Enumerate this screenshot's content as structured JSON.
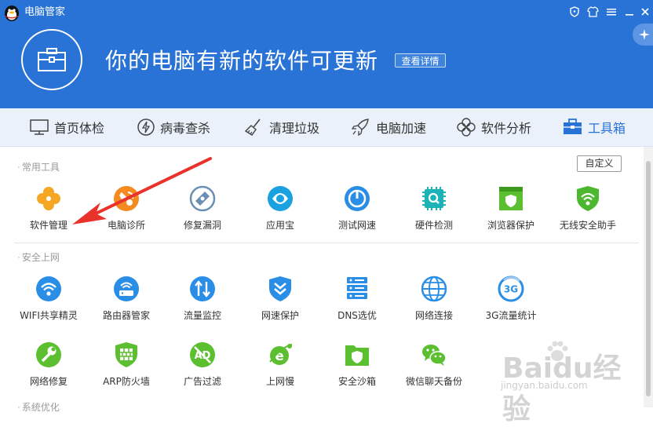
{
  "window": {
    "title": "电脑管家"
  },
  "banner": {
    "headline": "你的电脑有新的软件可更新",
    "detail_button": "查看详情"
  },
  "nav": {
    "items": [
      {
        "label": "首页体检"
      },
      {
        "label": "病毒查杀"
      },
      {
        "label": "清理垃圾"
      },
      {
        "label": "电脑加速"
      },
      {
        "label": "软件分析"
      },
      {
        "label": "工具箱"
      }
    ]
  },
  "sections": [
    {
      "title": "常用工具",
      "tools": [
        {
          "label": "软件管理",
          "color": "#f5a623"
        },
        {
          "label": "电脑诊所",
          "color": "#f58a1f"
        },
        {
          "label": "修复漏洞",
          "color": "#6b8fb3"
        },
        {
          "label": "应用宝",
          "color": "#1aa2e0"
        },
        {
          "label": "测试网速",
          "color": "#2a8ee6"
        },
        {
          "label": "硬件检测",
          "color": "#1bb3b5"
        },
        {
          "label": "浏览器保护",
          "color": "#5bbf2f"
        },
        {
          "label": "无线安全助手",
          "color": "#4cb830"
        }
      ]
    },
    {
      "title": "安全上网",
      "tools": [
        {
          "label": "WIFI共享精灵",
          "color": "#2a8ee6"
        },
        {
          "label": "路由器管家",
          "color": "#2a8ee6"
        },
        {
          "label": "流量监控",
          "color": "#2a8ee6"
        },
        {
          "label": "网速保护",
          "color": "#2a8ee6"
        },
        {
          "label": "DNS选优",
          "color": "#2a8ee6"
        },
        {
          "label": "网络连接",
          "color": "#2a8ee6"
        },
        {
          "label": "3G流量统计",
          "color": "#2a8ee6"
        }
      ]
    },
    {
      "title": "系统优化",
      "tools": [
        {
          "label": "网络修复",
          "color": "#5bbf2f"
        },
        {
          "label": "ARP防火墙",
          "color": "#5bbf2f"
        },
        {
          "label": "广告过滤",
          "color": "#5bbf2f"
        },
        {
          "label": "上网慢",
          "color": "#5bbf2f"
        },
        {
          "label": "安全沙箱",
          "color": "#5bbf2f"
        },
        {
          "label": "微信聊天备份",
          "color": "#5bbf2f"
        }
      ]
    }
  ],
  "custom_button": "自定义",
  "watermark": {
    "text": "Baidu经验",
    "sub": "jingyan.baidu.com"
  },
  "colors": {
    "header": "#2a73d6",
    "nav_bg": "#eaf1fa",
    "accent": "#2a73d6",
    "arrow": "#e8322a"
  }
}
